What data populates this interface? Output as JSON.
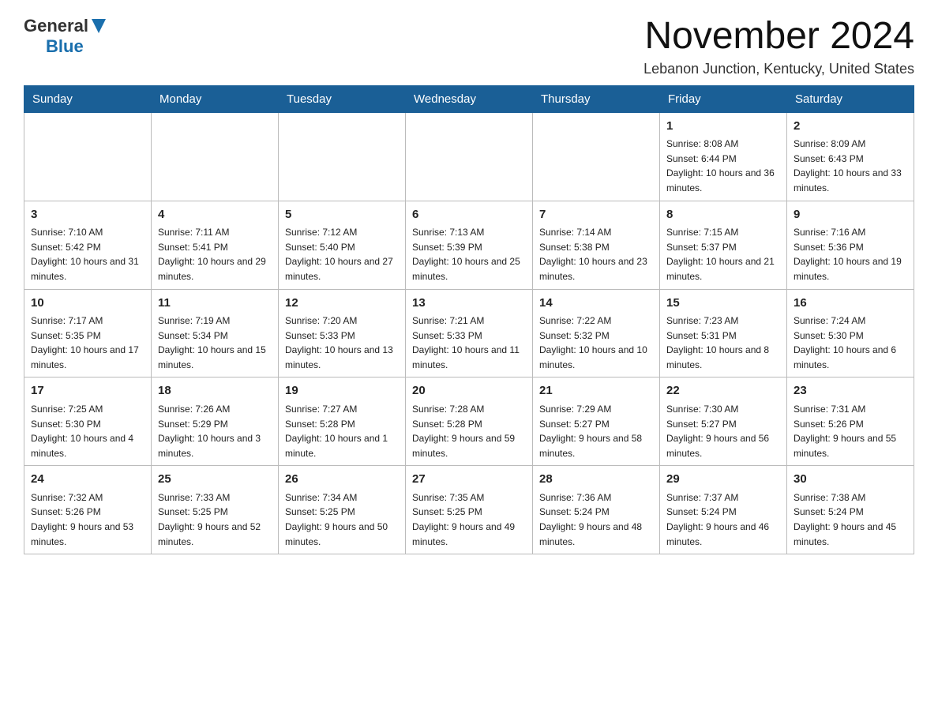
{
  "logo": {
    "general": "General",
    "blue": "Blue"
  },
  "header": {
    "month_title": "November 2024",
    "location": "Lebanon Junction, Kentucky, United States"
  },
  "days_of_week": [
    "Sunday",
    "Monday",
    "Tuesday",
    "Wednesday",
    "Thursday",
    "Friday",
    "Saturday"
  ],
  "weeks": [
    [
      {
        "day": "",
        "info": ""
      },
      {
        "day": "",
        "info": ""
      },
      {
        "day": "",
        "info": ""
      },
      {
        "day": "",
        "info": ""
      },
      {
        "day": "",
        "info": ""
      },
      {
        "day": "1",
        "info": "Sunrise: 8:08 AM\nSunset: 6:44 PM\nDaylight: 10 hours and 36 minutes."
      },
      {
        "day": "2",
        "info": "Sunrise: 8:09 AM\nSunset: 6:43 PM\nDaylight: 10 hours and 33 minutes."
      }
    ],
    [
      {
        "day": "3",
        "info": "Sunrise: 7:10 AM\nSunset: 5:42 PM\nDaylight: 10 hours and 31 minutes."
      },
      {
        "day": "4",
        "info": "Sunrise: 7:11 AM\nSunset: 5:41 PM\nDaylight: 10 hours and 29 minutes."
      },
      {
        "day": "5",
        "info": "Sunrise: 7:12 AM\nSunset: 5:40 PM\nDaylight: 10 hours and 27 minutes."
      },
      {
        "day": "6",
        "info": "Sunrise: 7:13 AM\nSunset: 5:39 PM\nDaylight: 10 hours and 25 minutes."
      },
      {
        "day": "7",
        "info": "Sunrise: 7:14 AM\nSunset: 5:38 PM\nDaylight: 10 hours and 23 minutes."
      },
      {
        "day": "8",
        "info": "Sunrise: 7:15 AM\nSunset: 5:37 PM\nDaylight: 10 hours and 21 minutes."
      },
      {
        "day": "9",
        "info": "Sunrise: 7:16 AM\nSunset: 5:36 PM\nDaylight: 10 hours and 19 minutes."
      }
    ],
    [
      {
        "day": "10",
        "info": "Sunrise: 7:17 AM\nSunset: 5:35 PM\nDaylight: 10 hours and 17 minutes."
      },
      {
        "day": "11",
        "info": "Sunrise: 7:19 AM\nSunset: 5:34 PM\nDaylight: 10 hours and 15 minutes."
      },
      {
        "day": "12",
        "info": "Sunrise: 7:20 AM\nSunset: 5:33 PM\nDaylight: 10 hours and 13 minutes."
      },
      {
        "day": "13",
        "info": "Sunrise: 7:21 AM\nSunset: 5:33 PM\nDaylight: 10 hours and 11 minutes."
      },
      {
        "day": "14",
        "info": "Sunrise: 7:22 AM\nSunset: 5:32 PM\nDaylight: 10 hours and 10 minutes."
      },
      {
        "day": "15",
        "info": "Sunrise: 7:23 AM\nSunset: 5:31 PM\nDaylight: 10 hours and 8 minutes."
      },
      {
        "day": "16",
        "info": "Sunrise: 7:24 AM\nSunset: 5:30 PM\nDaylight: 10 hours and 6 minutes."
      }
    ],
    [
      {
        "day": "17",
        "info": "Sunrise: 7:25 AM\nSunset: 5:30 PM\nDaylight: 10 hours and 4 minutes."
      },
      {
        "day": "18",
        "info": "Sunrise: 7:26 AM\nSunset: 5:29 PM\nDaylight: 10 hours and 3 minutes."
      },
      {
        "day": "19",
        "info": "Sunrise: 7:27 AM\nSunset: 5:28 PM\nDaylight: 10 hours and 1 minute."
      },
      {
        "day": "20",
        "info": "Sunrise: 7:28 AM\nSunset: 5:28 PM\nDaylight: 9 hours and 59 minutes."
      },
      {
        "day": "21",
        "info": "Sunrise: 7:29 AM\nSunset: 5:27 PM\nDaylight: 9 hours and 58 minutes."
      },
      {
        "day": "22",
        "info": "Sunrise: 7:30 AM\nSunset: 5:27 PM\nDaylight: 9 hours and 56 minutes."
      },
      {
        "day": "23",
        "info": "Sunrise: 7:31 AM\nSunset: 5:26 PM\nDaylight: 9 hours and 55 minutes."
      }
    ],
    [
      {
        "day": "24",
        "info": "Sunrise: 7:32 AM\nSunset: 5:26 PM\nDaylight: 9 hours and 53 minutes."
      },
      {
        "day": "25",
        "info": "Sunrise: 7:33 AM\nSunset: 5:25 PM\nDaylight: 9 hours and 52 minutes."
      },
      {
        "day": "26",
        "info": "Sunrise: 7:34 AM\nSunset: 5:25 PM\nDaylight: 9 hours and 50 minutes."
      },
      {
        "day": "27",
        "info": "Sunrise: 7:35 AM\nSunset: 5:25 PM\nDaylight: 9 hours and 49 minutes."
      },
      {
        "day": "28",
        "info": "Sunrise: 7:36 AM\nSunset: 5:24 PM\nDaylight: 9 hours and 48 minutes."
      },
      {
        "day": "29",
        "info": "Sunrise: 7:37 AM\nSunset: 5:24 PM\nDaylight: 9 hours and 46 minutes."
      },
      {
        "day": "30",
        "info": "Sunrise: 7:38 AM\nSunset: 5:24 PM\nDaylight: 9 hours and 45 minutes."
      }
    ]
  ]
}
